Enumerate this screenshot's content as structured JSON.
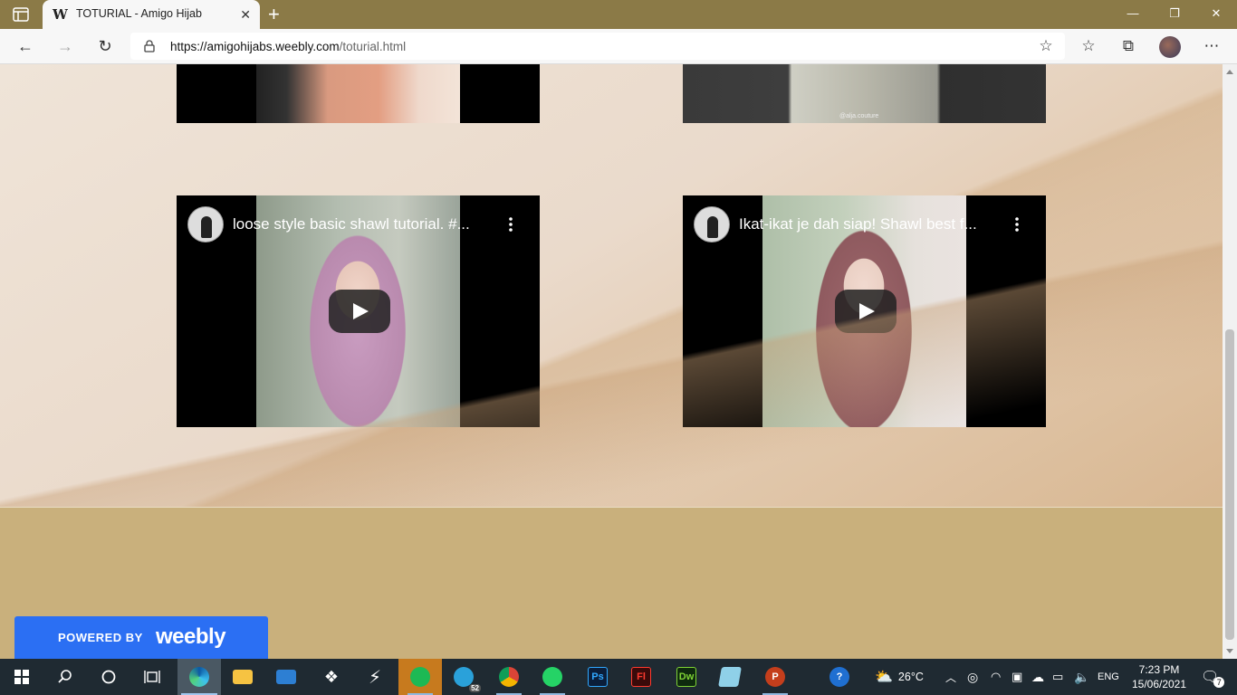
{
  "browser": {
    "tab_title": "TOTURIAL - Amigo Hijab",
    "favicon_letter": "W",
    "url_domain": "https://amigohijabs.weebly.com",
    "url_path": "/toturial.html",
    "new_tab_glyph": "+"
  },
  "page": {
    "videos": [
      {
        "title": "loose style basic shawl tutorial. #..."
      },
      {
        "title": "Ikat-ikat je dah siap! Shawl best f..."
      }
    ],
    "top_video_watermark": "@alja.couture"
  },
  "weebly_badge": {
    "powered": "POWERED BY",
    "brand": "weebly"
  },
  "taskbar": {
    "telegram_badge": "52",
    "weather_temp": "26°C",
    "language": "ENG",
    "time": "7:23 PM",
    "date": "15/06/2021",
    "notification_count": "7",
    "ps_label": "Ps",
    "fl_label": "Fl",
    "dw_label": "Dw",
    "ppt_label": "P"
  }
}
